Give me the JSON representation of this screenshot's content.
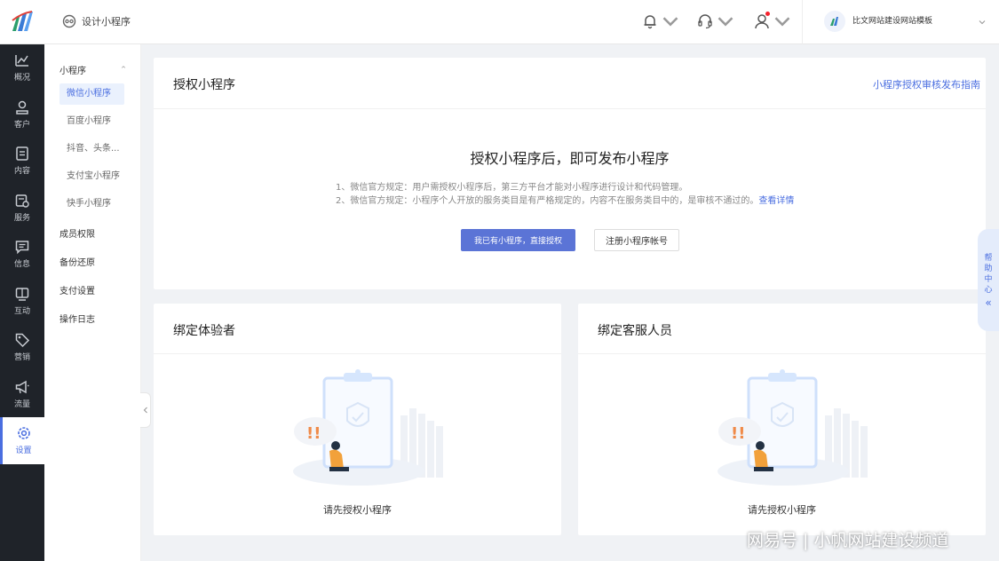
{
  "header": {
    "breadcrumb": "设计小程序",
    "org_name": "比文网站建设网站模板"
  },
  "nav": {
    "items": [
      {
        "label": "概况"
      },
      {
        "label": "客户"
      },
      {
        "label": "内容"
      },
      {
        "label": "服务"
      },
      {
        "label": "信息"
      },
      {
        "label": "互动"
      },
      {
        "label": "营销"
      },
      {
        "label": "流量"
      },
      {
        "label": "设置"
      }
    ]
  },
  "subnav": {
    "group": "小程序",
    "group_arrow": "^",
    "items": [
      "微信小程序",
      "百度小程序",
      "抖音、头条...",
      "支付宝小程序",
      "快手小程序"
    ],
    "others": [
      "成员权限",
      "备份还原",
      "支付设置",
      "操作日志"
    ]
  },
  "auth_card": {
    "title": "授权小程序",
    "guide_link": "小程序授权审核发布指南",
    "heading": "授权小程序后，即可发布小程序",
    "rule1": "1、微信官方规定：用户需授权小程序后，第三方平台才能对小程序进行设计和代码管理。",
    "rule2": "2、微信官方规定：小程序个人开放的服务类目是有严格规定的，内容不在服务类目中的，是审核不通过的。",
    "rule2_link": "查看详情",
    "btn_authorize": "我已有小程序，直接授权",
    "btn_register": "注册小程序帐号"
  },
  "tester_card": {
    "title": "绑定体验者",
    "empty": "请先授权小程序"
  },
  "service_card": {
    "title": "绑定客服人员",
    "empty": "请先授权小程序"
  },
  "help_tab": {
    "label_chars": [
      "帮",
      "助",
      "中",
      "心"
    ],
    "chevron": "«"
  },
  "watermark": "网易号 | 小帆网站建设频道",
  "colors": {
    "accent": "#4a6ee0",
    "primary_button": "#5b74d6",
    "sidebar_bg": "#1f2329"
  }
}
